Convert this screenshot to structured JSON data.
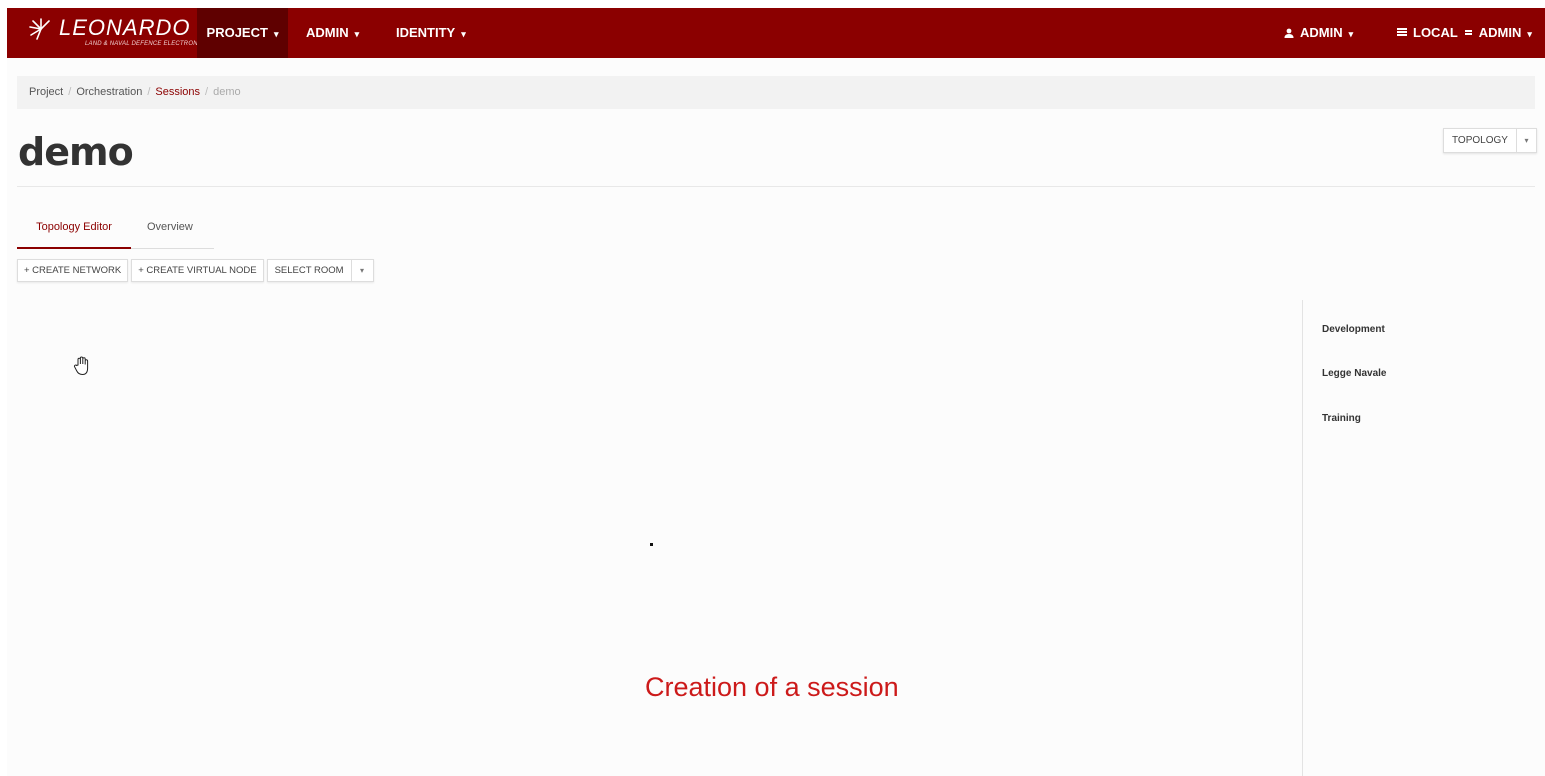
{
  "brand": {
    "name": "LEONARDO",
    "subtitle": "LAND & NAVAL DEFENCE ELECTRONICS",
    "color": "#8b0000"
  },
  "navbar": {
    "items": [
      {
        "label": "PROJECT",
        "active": true,
        "icon": "chevron-down-icon"
      },
      {
        "label": "ADMIN",
        "active": false,
        "icon": "chevron-down-icon"
      },
      {
        "label": "IDENTITY",
        "active": false,
        "icon": "chevron-down-icon"
      }
    ],
    "user": {
      "label": "ADMIN",
      "icon": "user-icon"
    },
    "region": {
      "domain": "LOCAL",
      "project": "ADMIN",
      "icon": "list-icon"
    }
  },
  "breadcrumb": {
    "items": [
      "Project",
      "Orchestration",
      "Sessions",
      "demo"
    ]
  },
  "page": {
    "title": "demo",
    "view_selector": "TOPOLOGY"
  },
  "tabs": [
    {
      "label": "Topology Editor",
      "active": true
    },
    {
      "label": "Overview",
      "active": false
    }
  ],
  "toolbar": {
    "create_network": "+ CREATE NETWORK",
    "create_virtual_node": "+ CREATE VIRTUAL NODE",
    "select_room": "SELECT ROOM"
  },
  "rooms": [
    "Development",
    "Legge Navale",
    "Training"
  ],
  "overlay": {
    "caption": "Creation of a session",
    "caption_color": "#cc1a1a"
  }
}
